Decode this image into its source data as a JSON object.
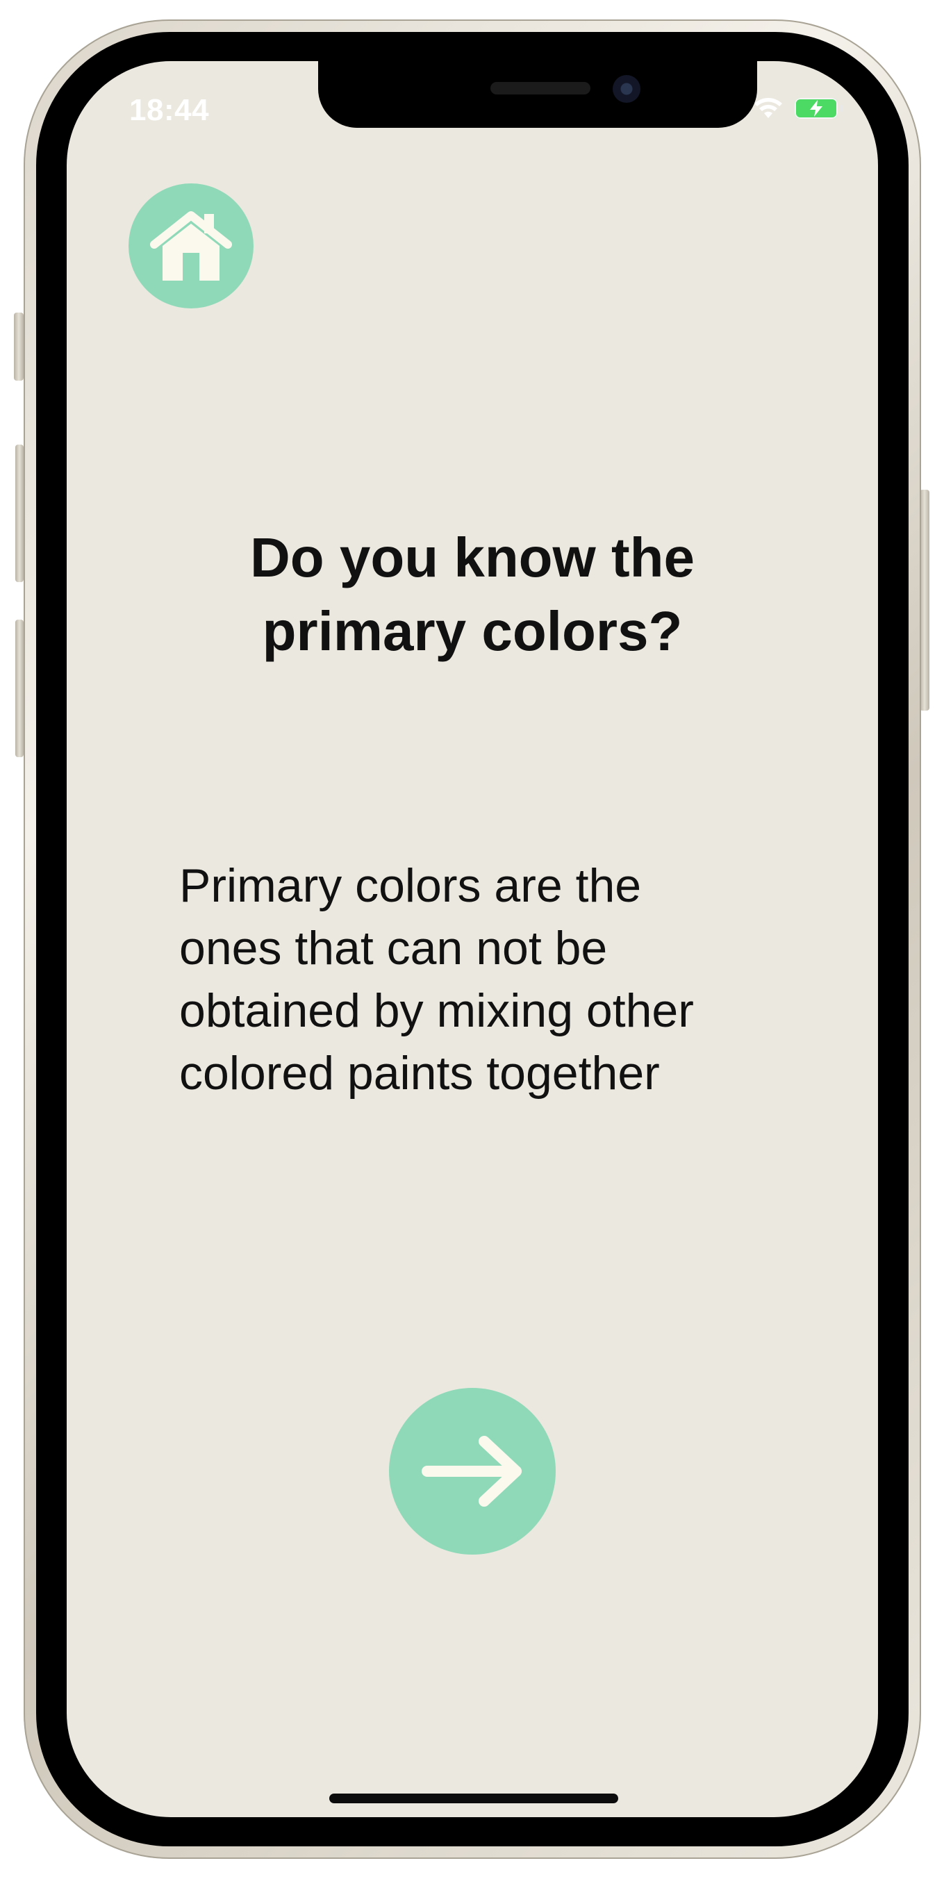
{
  "status_bar": {
    "time": "18:44",
    "signal_dots": "....",
    "wifi_icon": "wifi-icon",
    "battery_icon": "battery-charging-icon"
  },
  "nav": {
    "home_icon": "home-icon"
  },
  "content": {
    "title": "Do you know the\nprimary colors?",
    "body": "Primary colors are the\nones that can not be\nobtained by mixing other\ncolored paints together"
  },
  "actions": {
    "next_icon": "arrow-right-icon"
  },
  "colors": {
    "background": "#ebe8df",
    "accent": "#8fd9b9",
    "icon_fill": "#fbf9ee",
    "text": "#111111"
  }
}
